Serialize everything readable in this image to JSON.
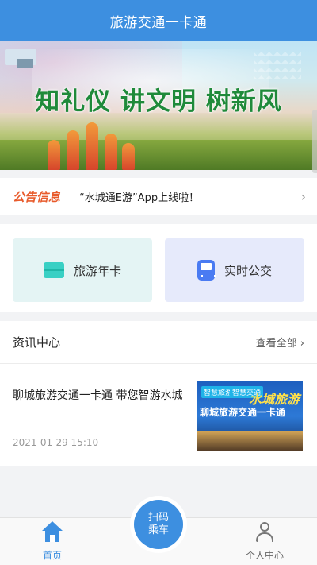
{
  "header": {
    "title": "旅游交通一卡通"
  },
  "banner": {
    "slogan": "知礼仪 讲文明 树新风"
  },
  "notice": {
    "tag": "公告信息",
    "text": "“水城通E游”App上线啦！",
    "chevron": "›"
  },
  "services": [
    {
      "label": "旅游年卡",
      "icon": "card-icon"
    },
    {
      "label": "实时公交",
      "icon": "bus-icon"
    }
  ],
  "news": {
    "title": "资讯中心",
    "more": "查看全部 ›",
    "items": [
      {
        "headline": "聊城旅游交通一卡通 带您智游水城",
        "date": "2021-01-29 15:10",
        "thumb": {
          "tag1": "智慧旅游",
          "tag2": "智慧交通",
          "title": "聊城旅游交通一卡通",
          "art": "水城旅游"
        }
      }
    ]
  },
  "tabbar": {
    "home": "首页",
    "scan_line1": "扫码",
    "scan_line2": "乘车",
    "me": "个人中心"
  },
  "colors": {
    "primary": "#3d8fe0",
    "notice_tag": "#e85b2c",
    "slogan": "#1f8a3a"
  }
}
